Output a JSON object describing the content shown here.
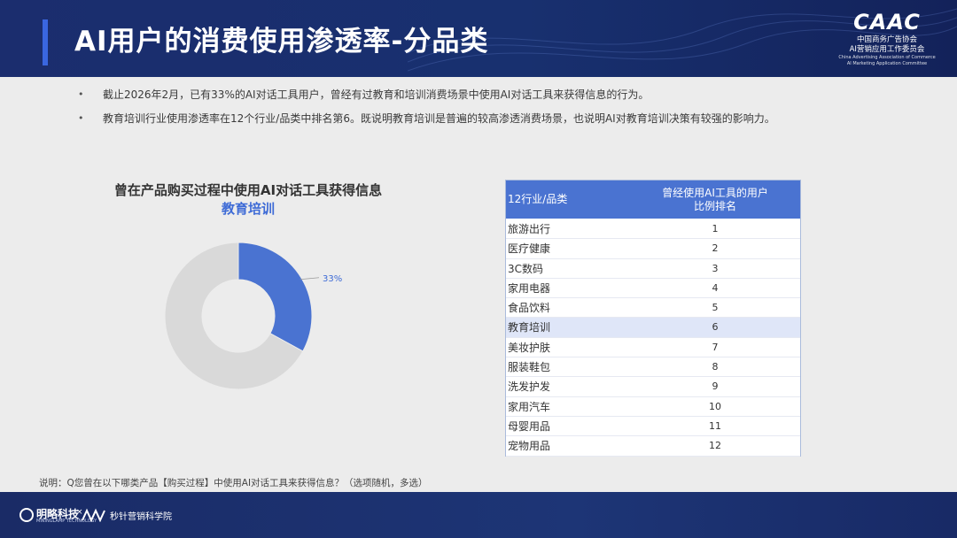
{
  "header": {
    "title": "AI用户的消费使用渗透率-分品类",
    "logo": {
      "mark": "CAAC",
      "cn": "中国商务广告协会",
      "cn2": "AI营销应用工作委员会",
      "en1": "China Advertising Association of Commerce",
      "en2": "AI Marketing Application Committee"
    }
  },
  "bullets": [
    {
      "marker": "•",
      "text": "截止2026年2月，已有33%的AI对话工具用户，曾经有过教育和培训消费场景中使用AI对话工具来获得信息的行为。"
    },
    {
      "marker": "•",
      "text": "教育培训行业使用渗透率在12个行业/品类中排名第6。既说明教育培训是普遍的较高渗透消费场景，也说明AI对教育培训决策有较强的影响力。"
    }
  ],
  "chart_data": [
    {
      "type": "pie",
      "title": "曾在产品购买过程中使用AI对话工具获得信息",
      "subtitle": "教育培训",
      "slices": [
        {
          "label": "33%",
          "value": 33,
          "color": "#4a73d1"
        },
        {
          "label": "",
          "value": 67,
          "color": "#d9d9d9"
        }
      ],
      "donut": true
    },
    {
      "type": "table",
      "columns": [
        "12行业/品类",
        "曾经使用AI工具的用户",
        "比例排名"
      ],
      "rows": [
        [
          "旅游出行",
          "1"
        ],
        [
          "医疗健康",
          "2"
        ],
        [
          "3C数码",
          "3"
        ],
        [
          "家用电器",
          "4"
        ],
        [
          "食品饮料",
          "5"
        ],
        [
          "教育培训",
          "6"
        ],
        [
          "美妆护肤",
          "7"
        ],
        [
          "服装鞋包",
          "8"
        ],
        [
          "洗发护发",
          "9"
        ],
        [
          "家用汽车",
          "10"
        ],
        [
          "母婴用品",
          "11"
        ],
        [
          "宠物用品",
          "12"
        ]
      ],
      "highlight_row": 5,
      "header_color": "#4a73d1",
      "highlight_color": "#dfe6f8"
    }
  ],
  "note": "说明：Q您曾在以下哪类产品【购买过程】中使用AI对话工具来获得信息？（选项随机，多选）",
  "footer": {
    "brand1": "明略科技",
    "brand1_sub": "MININGLAMP TECHNOLOGY",
    "separator": "×",
    "brand2": "秒针营销科学院"
  }
}
